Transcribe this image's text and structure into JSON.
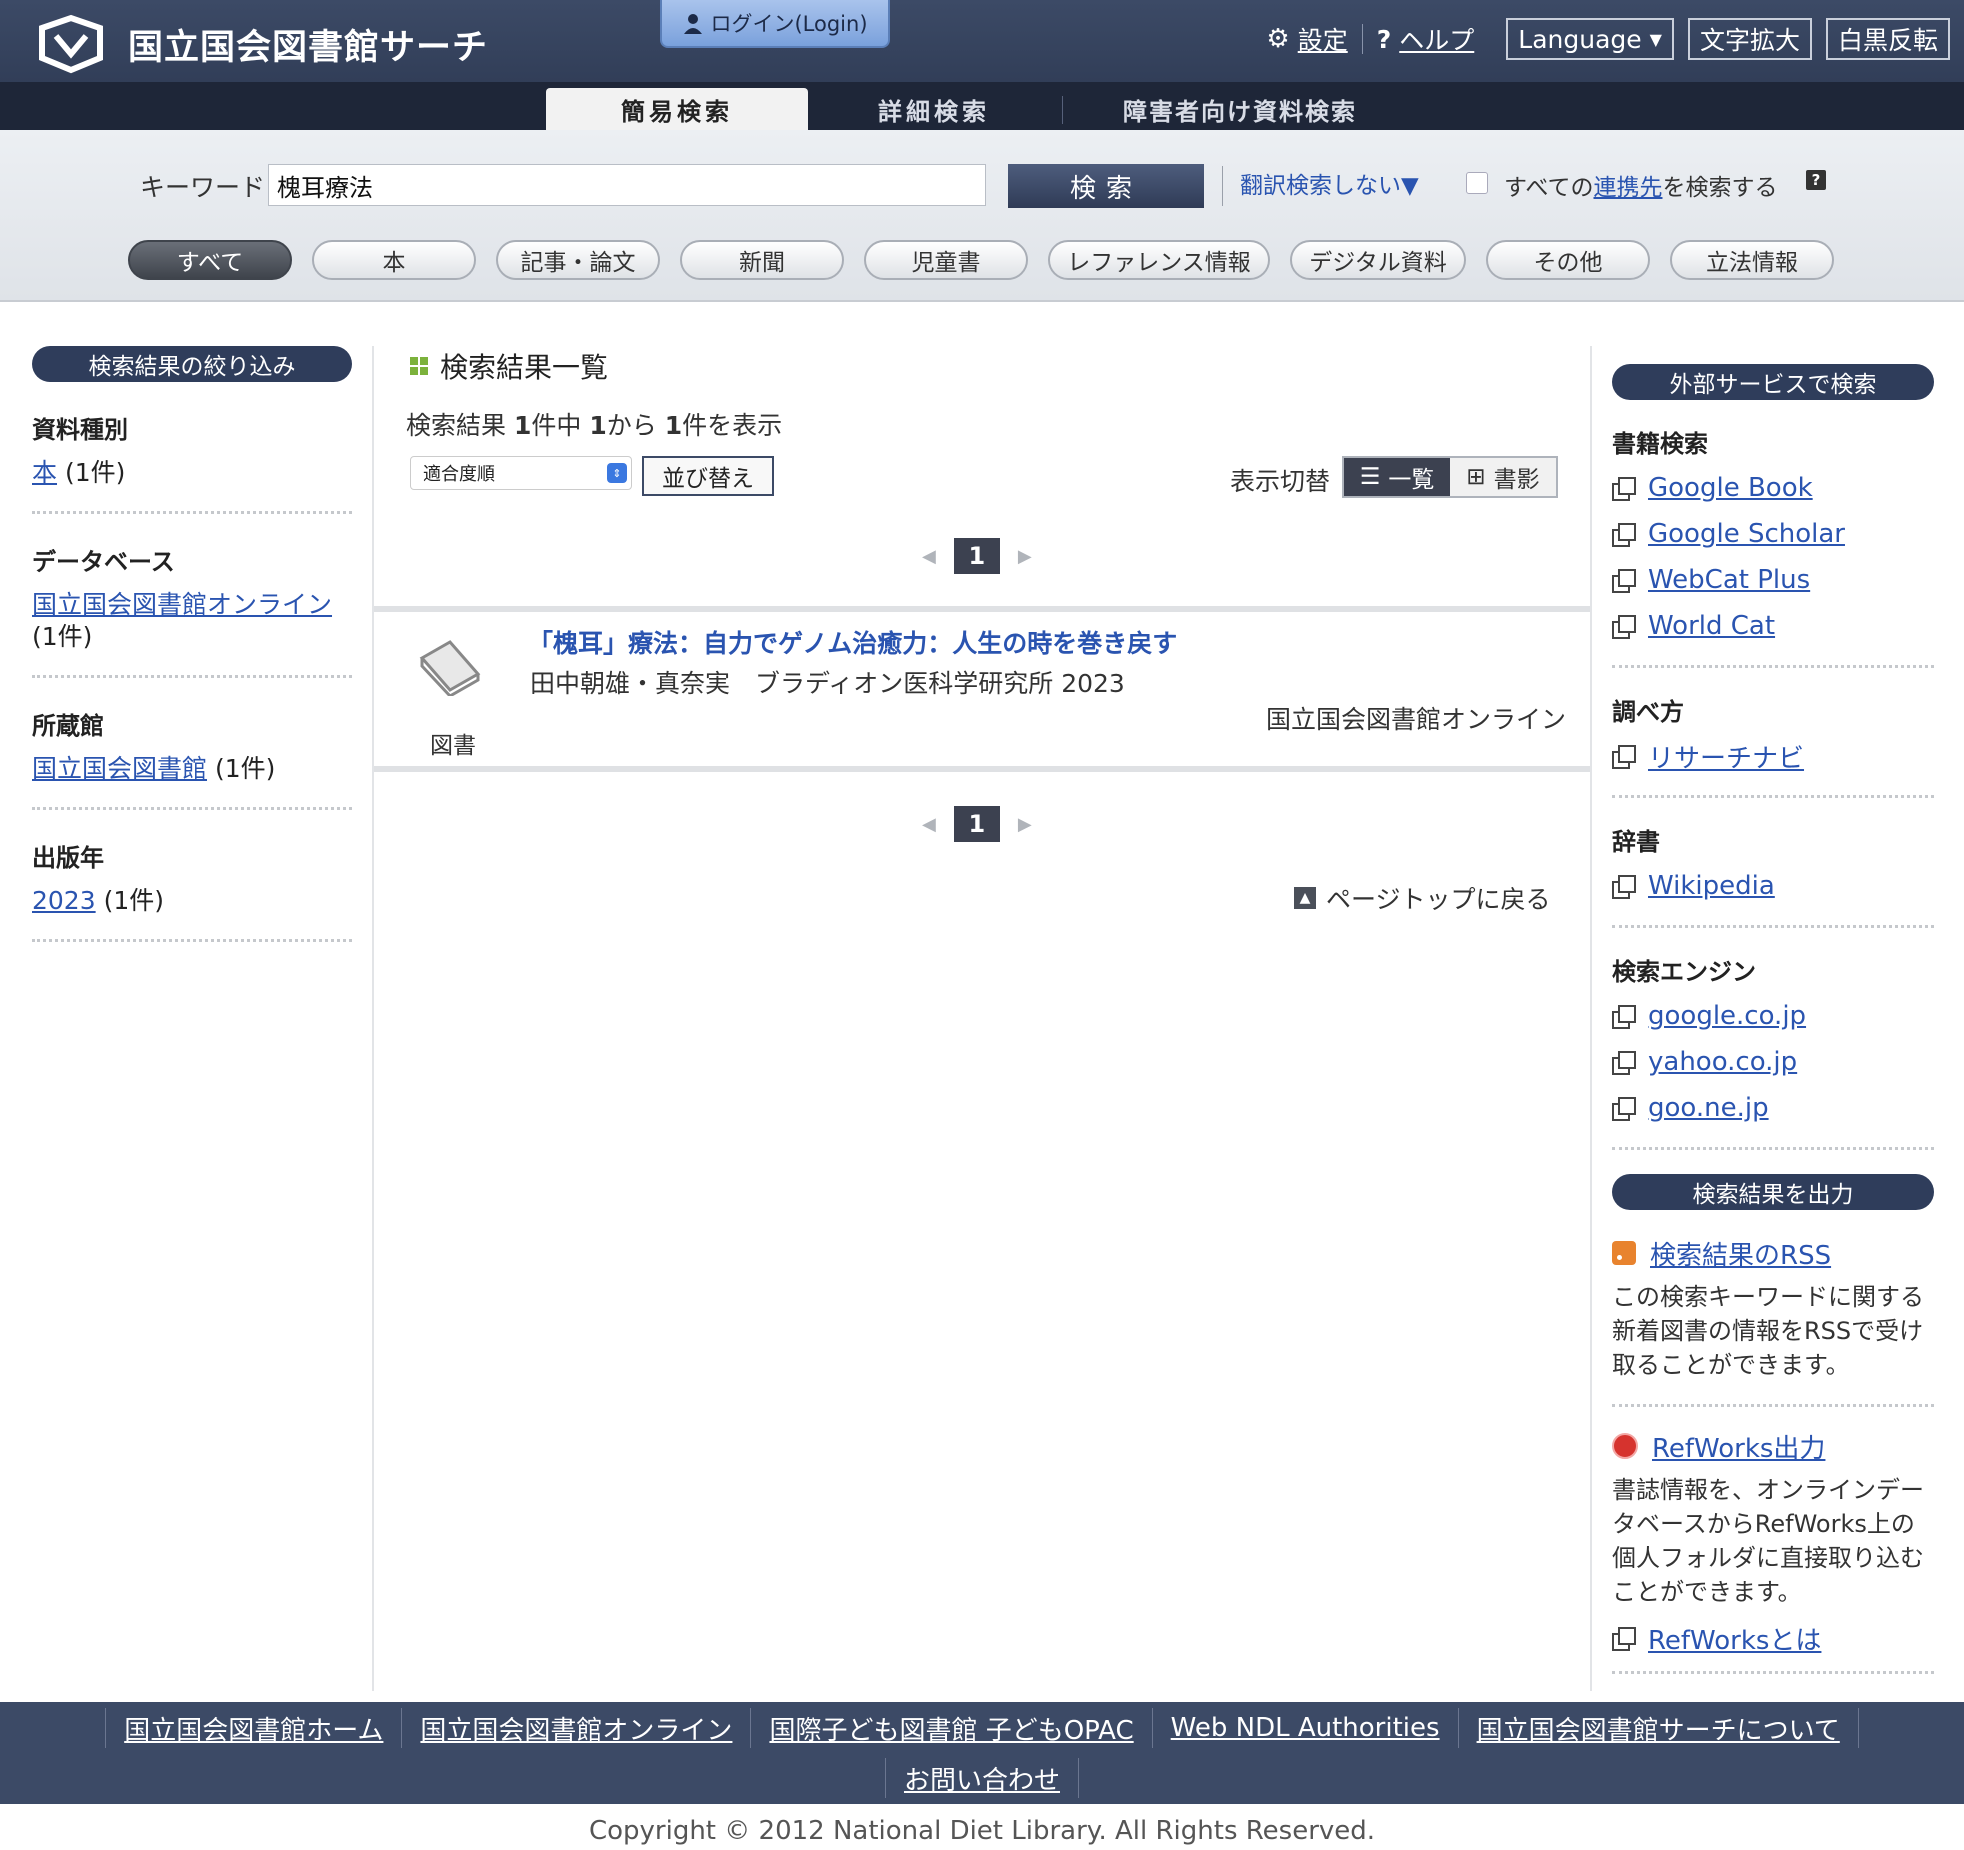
{
  "header": {
    "site_title": "国立国会図書館サーチ",
    "login_label": "ログイン(Login)",
    "settings_label": "設定",
    "help_label": "ヘルプ",
    "language_label": "Language",
    "font_size_label": "文字拡大",
    "contrast_label": "白黒反転"
  },
  "tabs": [
    {
      "label": "簡易検索"
    },
    {
      "label": "詳細検索"
    },
    {
      "label": "障害者向け資料検索"
    }
  ],
  "search": {
    "keyword_label": "キーワード",
    "keyword_value": "槐耳療法",
    "search_button": "検索",
    "translate_toggle": "翻訳検索しない▼",
    "all_sources_prefix": "すべての",
    "all_sources_link": "連携先",
    "all_sources_suffix": "を検索する"
  },
  "categories": [
    "すべて",
    "本",
    "記事・論文",
    "新聞",
    "児童書",
    "レファレンス情報",
    "デジタル資料",
    "その他",
    "立法情報"
  ],
  "refine": {
    "title": "検索結果の絞り込み",
    "facets": [
      {
        "title": "資料種別",
        "link": "本",
        "count": "(1件)"
      },
      {
        "title": "データベース",
        "link": "国立国会図書館オンライン",
        "count": "(1件)"
      },
      {
        "title": "所蔵館",
        "link": "国立国会図書館",
        "count": "(1件)"
      },
      {
        "title": "出版年",
        "link": "2023",
        "count": "(1件)"
      }
    ]
  },
  "results": {
    "heading": "検索結果一覧",
    "count_text_1": "検索結果",
    "count_total": "1",
    "count_text_2": "件中",
    "count_from": "1",
    "count_text_3": "から",
    "count_to": "1",
    "count_text_4": "件を表示",
    "sort_option": "適合度順",
    "sort_button": "並び替え",
    "view_label": "表示切替",
    "view_list": "一覧",
    "view_cover": "書影",
    "page_number": "1",
    "items": [
      {
        "title": "「槐耳」療法：自力でゲノム治癒力：人生の時を巻き戻す",
        "meta": "田中朝雄・真奈実　ブラディオン医科学研究所 2023",
        "type": "図書",
        "source": "国立国会図書館オンライン"
      }
    ],
    "page_top": "ページトップに戻る"
  },
  "external": {
    "title": "外部サービスで検索",
    "sections": [
      {
        "title": "書籍検索",
        "links": [
          "Google Book",
          "Google Scholar",
          "WebCat Plus",
          "World Cat"
        ]
      },
      {
        "title": "調べ方",
        "links": [
          "リサーチナビ"
        ]
      },
      {
        "title": "辞書",
        "links": [
          "Wikipedia"
        ]
      },
      {
        "title": "検索エンジン",
        "links": [
          "google.co.jp",
          "yahoo.co.jp",
          "goo.ne.jp"
        ]
      }
    ],
    "export_title": "検索結果を出力",
    "rss_link": "検索結果のRSS",
    "rss_desc": "この検索キーワードに関する新着図書の情報をRSSで受け取ることができます。",
    "refworks_link": "RefWorks出力",
    "refworks_desc": "書誌情報を、オンラインデータベースからRefWorks上の個人フォルダに直接取り込むことができます。",
    "refworks_about": "RefWorksとは"
  },
  "footer": {
    "links": [
      "国立国会図書館ホーム",
      "国立国会図書館オンライン",
      "国際子ども図書館 子どもOPAC",
      "Web NDL Authorities",
      "国立国会図書館サーチについて"
    ],
    "contact": "お問い合わせ",
    "copyright": "Copyright © 2012 National Diet Library. All Rights Reserved."
  },
  "colors": {
    "header_bg": "#2b3750",
    "link": "#2a54b0",
    "accent_green": "#7cb23c"
  }
}
